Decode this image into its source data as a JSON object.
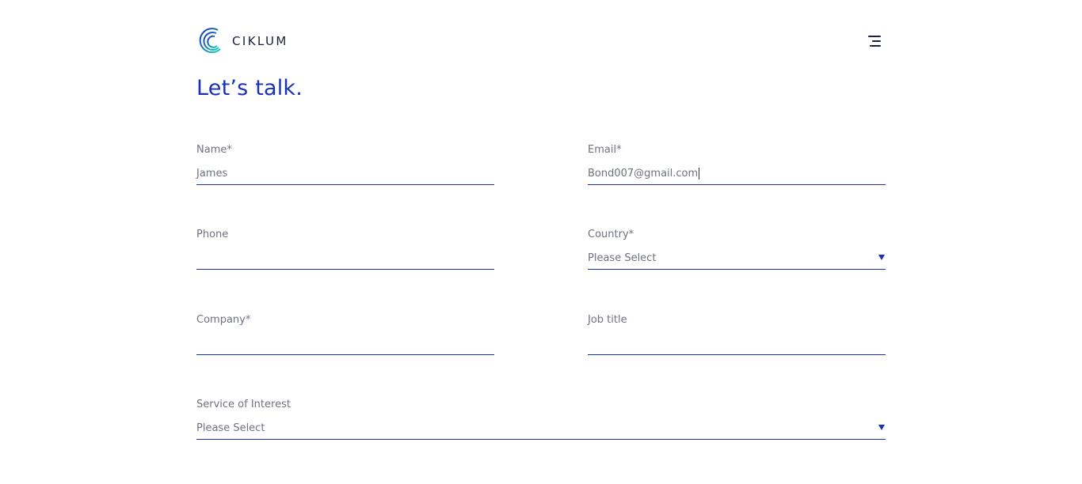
{
  "brand": {
    "name": "CIKLUM",
    "accent_color": "#1a30b8",
    "logo_gradient": [
      "#1a30b8",
      "#17d6b8"
    ]
  },
  "header": {
    "menu_icon": "hamburger-menu-icon"
  },
  "page": {
    "title": "Let’s talk."
  },
  "form": {
    "name": {
      "label": "Name*",
      "value": "James"
    },
    "email": {
      "label": "Email*",
      "value": "Bond007@gmail.com"
    },
    "phone": {
      "label": "Phone",
      "value": ""
    },
    "country": {
      "label": "Country*",
      "selected": "Please Select",
      "caret_icon": "caret-down-icon"
    },
    "company": {
      "label": "Company*",
      "value": ""
    },
    "job_title": {
      "label": "Job title",
      "value": ""
    },
    "service": {
      "label": "Service of Interest",
      "selected": "Please Select",
      "caret_icon": "caret-down-icon"
    }
  }
}
